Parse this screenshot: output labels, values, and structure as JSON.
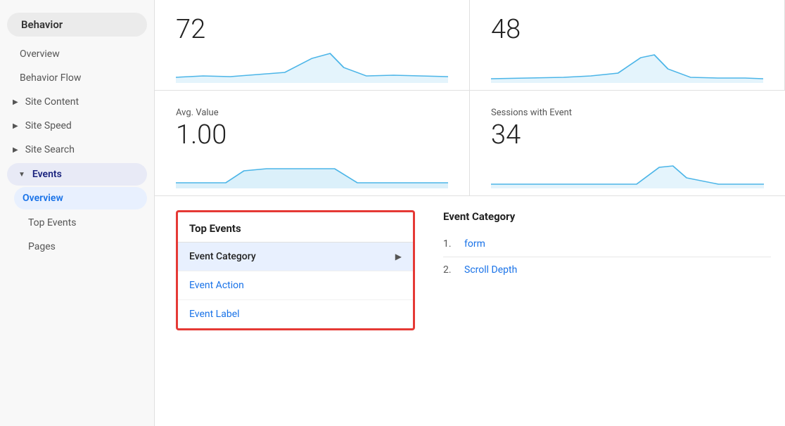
{
  "sidebar": {
    "behavior_label": "Behavior",
    "items": [
      {
        "id": "overview",
        "label": "Overview",
        "type": "plain",
        "indent": "normal"
      },
      {
        "id": "behavior-flow",
        "label": "Behavior Flow",
        "type": "plain",
        "indent": "normal"
      },
      {
        "id": "site-content",
        "label": "Site Content",
        "type": "expandable",
        "arrow": "▶"
      },
      {
        "id": "site-speed",
        "label": "Site Speed",
        "type": "expandable",
        "arrow": "▶"
      },
      {
        "id": "site-search",
        "label": "Site Search",
        "type": "expandable",
        "arrow": "▶"
      },
      {
        "id": "events",
        "label": "Events",
        "type": "expandable-open",
        "arrow": "▼"
      },
      {
        "id": "events-overview",
        "label": "Overview",
        "type": "sub-active"
      },
      {
        "id": "top-events",
        "label": "Top Events",
        "type": "sub"
      },
      {
        "id": "pages",
        "label": "Pages",
        "type": "sub"
      }
    ]
  },
  "stats": {
    "top_left": {
      "value": "72",
      "sparkline_type": "spike"
    },
    "top_right": {
      "value": "48",
      "sparkline_type": "spike2"
    },
    "bottom_left": {
      "label": "Avg. Value",
      "value": "1.00",
      "sparkline_type": "plateau"
    },
    "bottom_right": {
      "label": "Sessions with Event",
      "value": "34",
      "sparkline_type": "small_spike"
    }
  },
  "top_events": {
    "header": "Top Events",
    "items": [
      {
        "id": "event-category",
        "label": "Event Category",
        "active": true,
        "has_arrow": true
      },
      {
        "id": "event-action",
        "label": "Event Action",
        "active": false
      },
      {
        "id": "event-label",
        "label": "Event Label",
        "active": false
      }
    ]
  },
  "event_category": {
    "title": "Event Category",
    "items": [
      {
        "num": "1.",
        "label": "form"
      },
      {
        "num": "2.",
        "label": "Scroll Depth"
      }
    ]
  }
}
